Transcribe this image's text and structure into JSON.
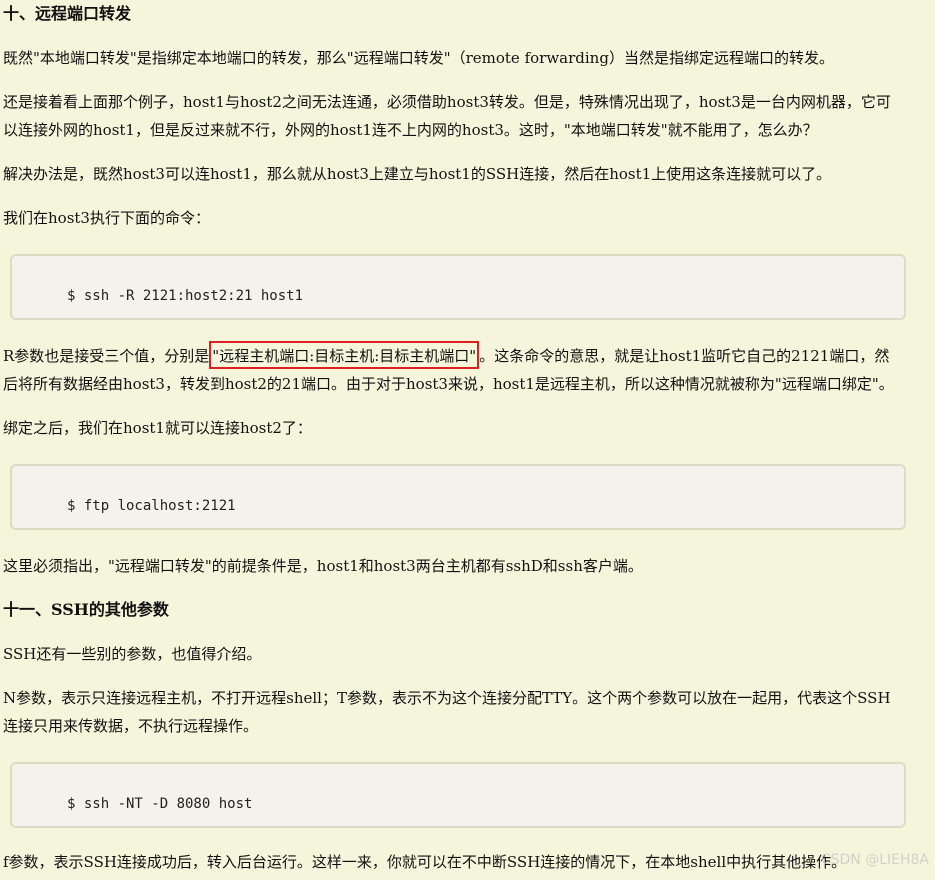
{
  "doc": {
    "h10": "十、远程端口转发",
    "p1": "既然\"本地端口转发\"是指绑定本地端口的转发，那么\"远程端口转发\"（remote forwarding）当然是指绑定远程端口的转发。",
    "p2_l1": "还是接着看上面那个例子，host1与host2之间无法连通，必须借助host3转发。但是，特殊情况出现了，host3是一台内网机器，它可",
    "p2_l2": "以连接外网的host1，但是反过来就不行，外网的host1连不上内网的host3。这时，\"本地端口转发\"就不能用了，怎么办？",
    "p3": "解决办法是，既然host3可以连host1，那么就从host3上建立与host1的SSH连接，然后在host1上使用这条连接就可以了。",
    "p4": "我们在host3执行下面的命令：",
    "code1": "$ ssh -R 2121:host2:21 host1",
    "p5_l1_before": "R参数也是接受三个值，分别是",
    "p5_l1_highlight": "\"远程主机端口:目标主机:目标主机端口\"",
    "p5_l1_after": "。这条命令的意思，就是让host1监听它自己的2121端口，然",
    "p5_l2": "后将所有数据经由host3，转发到host2的21端口。由于对于host3来说，host1是远程主机，所以这种情况就被称为\"远程端口绑定\"。",
    "p6": "绑定之后，我们在host1就可以连接host2了：",
    "code2": "$ ftp localhost:2121",
    "p7": "这里必须指出，\"远程端口转发\"的前提条件是，host1和host3两台主机都有sshD和ssh客户端。",
    "h11": "十一、SSH的其他参数",
    "p8": "SSH还有一些别的参数，也值得介绍。",
    "p9_l1": "N参数，表示只连接远程主机，不打开远程shell；T参数，表示不为这个连接分配TTY。这个两个参数可以放在一起用，代表这个SSH",
    "p9_l2": "连接只用来传数据，不执行远程操作。",
    "code3": "$ ssh -NT -D 8080 host",
    "p10": "f参数，表示SSH连接成功后，转入后台运行。这样一来，你就可以在不中断SSH连接的情况下，在本地shell中执行其他操作。"
  },
  "watermark": "CSDN @LIEH8A"
}
